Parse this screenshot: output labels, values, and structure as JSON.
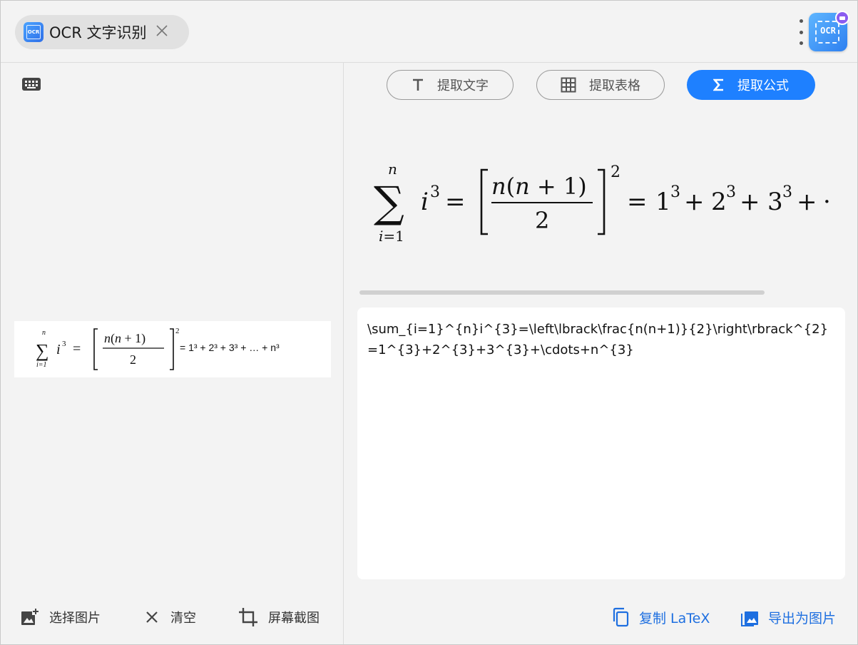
{
  "tab": {
    "title": "OCR 文字识别",
    "logo_text": "OCR",
    "close_glyph": "✕"
  },
  "app_logo": {
    "text": "OCR"
  },
  "left": {
    "source_image": {
      "alt": "\\sum_{i=1}^{n} i^3 = [n(n+1)/2]^2 = 1³ + 2³ + 3³ + … + n³",
      "tail_text": "= 1³ + 2³ + 3³ + … + n³"
    },
    "actions": {
      "select_image": "选择图片",
      "clear": "清空",
      "screenshot": "屏幕截图"
    }
  },
  "modes": [
    {
      "label": "提取文字",
      "icon": "text-T-icon",
      "active": false
    },
    {
      "label": "提取表格",
      "icon": "table-grid-icon",
      "active": false
    },
    {
      "label": "提取公式",
      "icon": "sigma-icon",
      "active": true
    }
  ],
  "result": {
    "latex": "\\sum_{i=1}^{n}i^{3}=\\left\\lbrack\\frac{n(n+1)}{2}\\right\\rbrack^{2}=1^{3}+2^{3}+3^{3}+\\cdots+n^{3}"
  },
  "right_actions": {
    "copy_latex": "复制 LaTeX",
    "export_image": "导出为图片"
  },
  "colors": {
    "accent": "#1e80ff",
    "link": "#1e6fe0",
    "background": "#f3f3f3"
  }
}
